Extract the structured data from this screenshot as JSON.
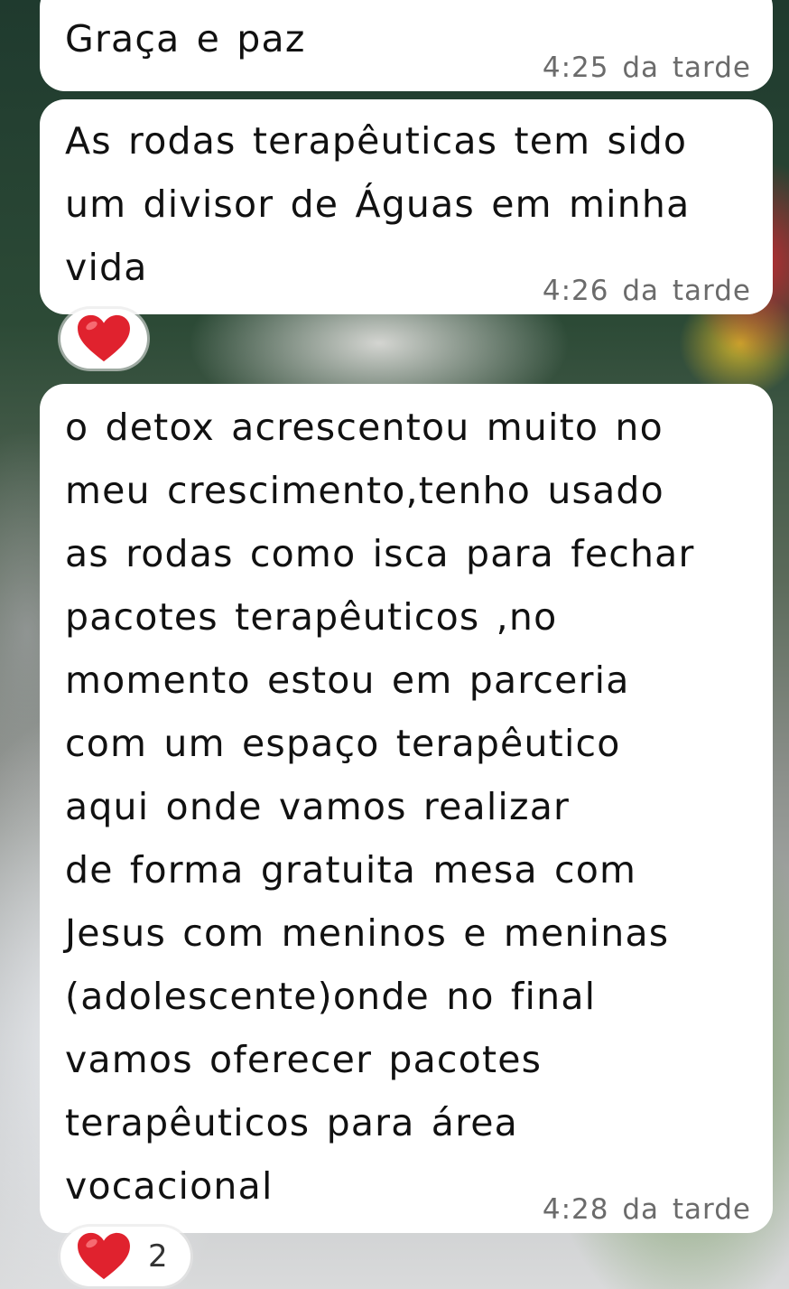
{
  "messages": [
    {
      "text": "Graça e paz",
      "time": "4:25 da tarde"
    },
    {
      "text": "As rodas terapêuticas tem sido\num divisor de Águas em minha\nvida",
      "time": "4:26 da tarde",
      "reaction": {
        "emoji": "heart-icon",
        "count": ""
      }
    },
    {
      "text": "o detox acrescentou muito no\nmeu crescimento,tenho usado\nas rodas como isca para fechar\npacotes terapêuticos ,no\nmomento estou em parceria\ncom um espaço terapêutico\naqui onde vamos realizar\nde forma gratuita mesa com\nJesus com meninos e meninas\n(adolescente)onde no final\nvamos oferecer pacotes\nterapêuticos para área\nvocacional",
      "time": "4:28 da tarde",
      "reaction": {
        "emoji": "heart-icon",
        "count": "2"
      }
    }
  ],
  "colors": {
    "bubble": "#ffffff",
    "text": "#111111",
    "time": "#6b6b6b",
    "heart": "#e0222e"
  }
}
